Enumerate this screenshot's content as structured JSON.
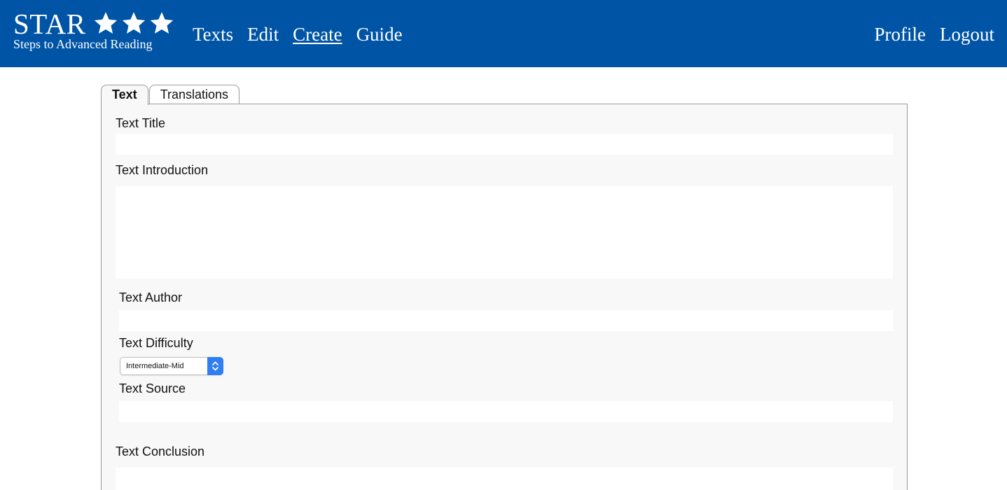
{
  "logo": {
    "title": "STAR",
    "subtitle": "Steps to Advanced Reading",
    "icon": "star-icon"
  },
  "nav": {
    "left": [
      "Texts",
      "Edit",
      "Create",
      "Guide"
    ],
    "right": [
      "Profile",
      "Logout"
    ],
    "active": "Create"
  },
  "tabs": [
    {
      "label": "Text"
    },
    {
      "label": "Translations"
    }
  ],
  "form": {
    "title_label": "Text Title",
    "title_value": "",
    "introduction_label": "Text Introduction",
    "introduction_value": "",
    "author_label": "Text Author",
    "author_value": "",
    "difficulty_label": "Text Difficulty",
    "difficulty_value": "Intermediate-Mid",
    "source_label": "Text Source",
    "source_value": "",
    "conclusion_label": "Text Conclusion",
    "conclusion_value": ""
  },
  "colors": {
    "header_bg": "#0054a6",
    "panel_bg": "#f8f8f8",
    "select_accent": "#2f7ef2"
  }
}
